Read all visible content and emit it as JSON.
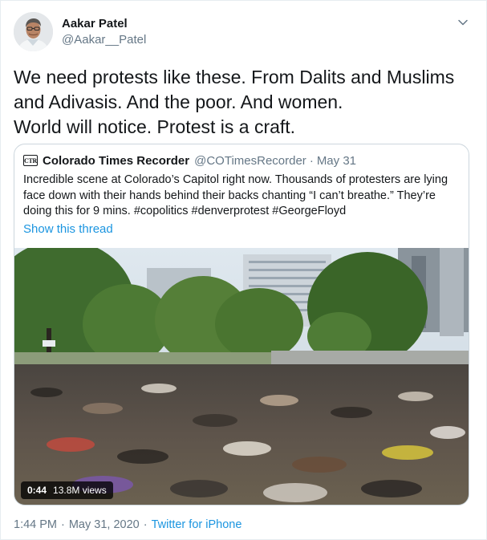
{
  "author": {
    "name": "Aakar Patel",
    "handle": "@Aakar__Patel"
  },
  "tweet": {
    "lines": [
      "We need protests like these. From Dalits and Muslims",
      "and Adivasis. And the poor. And women.",
      "World will notice. Protest is a craft."
    ]
  },
  "quoted_tweet": {
    "logo_text": "CTR",
    "name": "Colorado Times Recorder",
    "handle": "@COTimesRecorder",
    "separator": "·",
    "date": "May 31",
    "lines": [
      "Incredible scene at Colorado’s Capitol right now. Thousands of protesters are lying",
      "face down with their hands behind their backs chanting “I can’t breathe.” They’re",
      "doing this for 9 mins. #copolitics #denverprotest #GeorgeFloyd"
    ],
    "show_thread": "Show this thread",
    "video": {
      "duration": "0:44",
      "views": "13.8M views"
    }
  },
  "footer": {
    "time": "1:44 PM",
    "separator1": "·",
    "date": "May 31, 2020",
    "separator2": "·",
    "source": "Twitter for iPhone"
  },
  "colors": {
    "link": "#1b95e0",
    "secondary_text": "#657786",
    "border": "#ccd6dd"
  },
  "icons": {
    "caret": "chevron-down-icon",
    "quote_logo": "ctr-logo"
  }
}
